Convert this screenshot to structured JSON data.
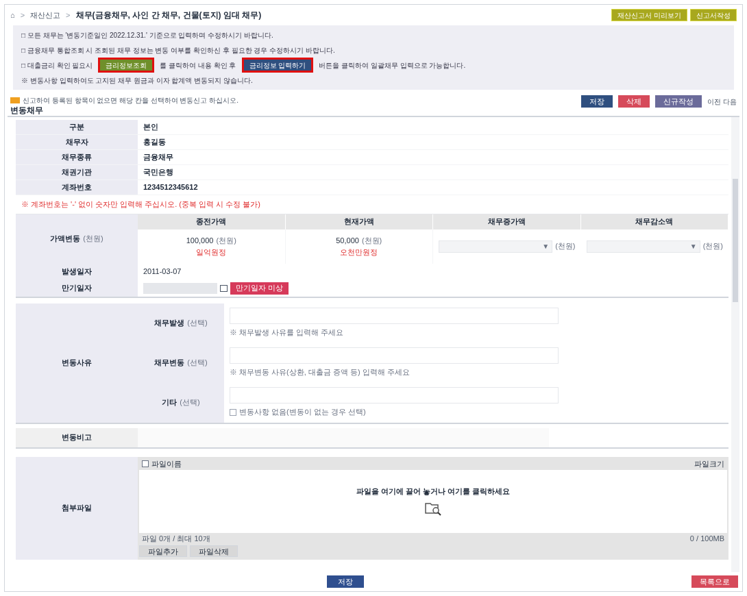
{
  "breadcrumb": {
    "home": "⌂",
    "separator": ">",
    "items": [
      "재산신고",
      "채무(금융채무, 사인 간 채무, 건물(토지) 임대 채무)"
    ]
  },
  "top_buttons": [
    "재산신고서 미리보기",
    "신고서작성"
  ],
  "notices": [
    {
      "segments": [
        {
          "kind": "text",
          "text": "□ 모든 채무는 '변동기준일인 2022.12.31.' 기준으로 입력하며 수정하시기 바랍니다."
        }
      ]
    },
    {
      "segments": [
        {
          "kind": "text",
          "text": "□ 금융채무 통합조회 시 조회된 채무 정보는 변동 여부를 확인하신 후 필요한 경우 수정하시기 바랍니다."
        }
      ]
    },
    {
      "segments": [
        {
          "kind": "text",
          "text": "□ 대출금리 확인 필요시"
        },
        {
          "kind": "button",
          "text": "금리정보조회",
          "color": "#6f8f2a",
          "highlighted": true
        },
        {
          "kind": "text",
          "text": "를 클릭하여 내용 확인 후"
        },
        {
          "kind": "button",
          "text": "금리정보 입력하기",
          "color": "#2f4f7f",
          "highlighted": true
        },
        {
          "kind": "text",
          "text": "버튼을 클릭하여 일괄채무 입력으로 가능합니다."
        }
      ]
    },
    {
      "segments": [
        {
          "kind": "text",
          "text": "※ 변동사항 입력하여도 고지된 채무 원금과 이자 합계액 변동되지 않습니다."
        }
      ]
    }
  ],
  "legend": "신고하여 등록된 항목이 없으면 해당 칸을 선택하여 변동신고 하십시오.",
  "section_title": "변동채무",
  "actions": [
    {
      "label": "저장",
      "color": "#2f4f7f"
    },
    {
      "label": "삭제",
      "color": "#d64a5a"
    },
    {
      "label": "신규작성",
      "color": "#6b6b9a"
    }
  ],
  "nav": "이전 다음",
  "details": [
    {
      "label": "구분",
      "value": "본인"
    },
    {
      "label": "채무자",
      "value": "홍길동"
    },
    {
      "label": "채무종류",
      "value": "금융채무"
    },
    {
      "label": "채권기관",
      "value": "국민은행"
    },
    {
      "label": "계좌번호",
      "value": "1234512345612"
    }
  ],
  "warning": "※ 계좌번호는 '-' 없이 숫자만 입력해 주십시오. (중복 입력 시 수정 불가)",
  "amounts": {
    "row_label": "가액변동",
    "row_unit": "(천원)",
    "columns": [
      "종전가액",
      "현재가액",
      "채무증가액",
      "채무감소액"
    ],
    "previous": {
      "value": "100,000",
      "unit": "(천원)",
      "words": "일억원정"
    },
    "current": {
      "value": "50,000",
      "unit": "(천원)",
      "words": "오천만원정"
    },
    "increase": {
      "unit": "(천원)",
      "caret": "▼"
    },
    "decrease": {
      "unit": "(천원)",
      "caret": "▼"
    }
  },
  "issue_date": {
    "label": "발생일자",
    "value": "2011-03-07"
  },
  "due_date": {
    "label": "만기일자",
    "button": "만기일자 미상"
  },
  "reason": {
    "label": "변동사유",
    "fields": [
      {
        "label": "채무발생",
        "hint": "(선택)",
        "note": "※ 채무발생 사유를 입력해 주세요"
      },
      {
        "label": "채무변동",
        "hint": "(선택)",
        "note": "※ 채무변동 사유(상환, 대출금 증액 등) 입력해 주세요"
      },
      {
        "label": "기타",
        "hint": "(선택)",
        "checkbox": {
          "checked": false,
          "label": "변동사항 없음(변동이 없는 경우 선택)"
        }
      }
    ]
  },
  "remarks": {
    "label": "변동비고"
  },
  "attachments": {
    "label": "첨부파일",
    "header": "파일이름",
    "select_all_checked": false,
    "size_header": "파일크기",
    "drop_text": "파일을 여기에 끌어 놓거나 여기를 클릭하세요",
    "status": "파일 0개 / 최대 10개",
    "limit": "0 / 100MB",
    "buttons": [
      "파일추가",
      "파일삭제"
    ]
  },
  "footer": {
    "save": "저장",
    "list": "목록으로"
  }
}
